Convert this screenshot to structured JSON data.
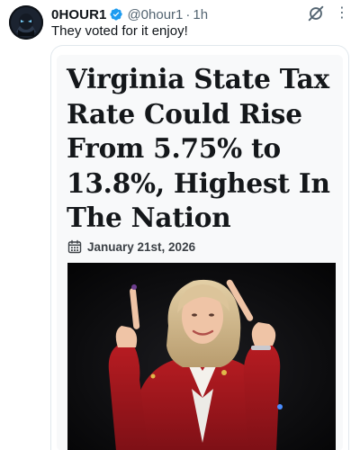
{
  "tweet": {
    "display_name": "0HOUR1",
    "handle": "@0hour1",
    "separator": "·",
    "time": "1h",
    "text": "They voted for it enjoy!",
    "verified_icon": "verified-badge-icon",
    "action_icon": "grok-icon",
    "more_icon": "more-vertical-icon",
    "more_glyph": "⋮"
  },
  "article": {
    "headline": "Virginia State Tax Rate Could Rise From 5.75% to 13.8%, Highest In The Nation",
    "date": "January 21st, 2026",
    "date_icon": "calendar-icon",
    "image": "photo of a woman in a red jacket pointing upward on a dark stage"
  },
  "colors": {
    "text": "#0f1419",
    "secondary": "#536471",
    "verified": "#1d9bf0",
    "jacket": "#a8171c"
  }
}
